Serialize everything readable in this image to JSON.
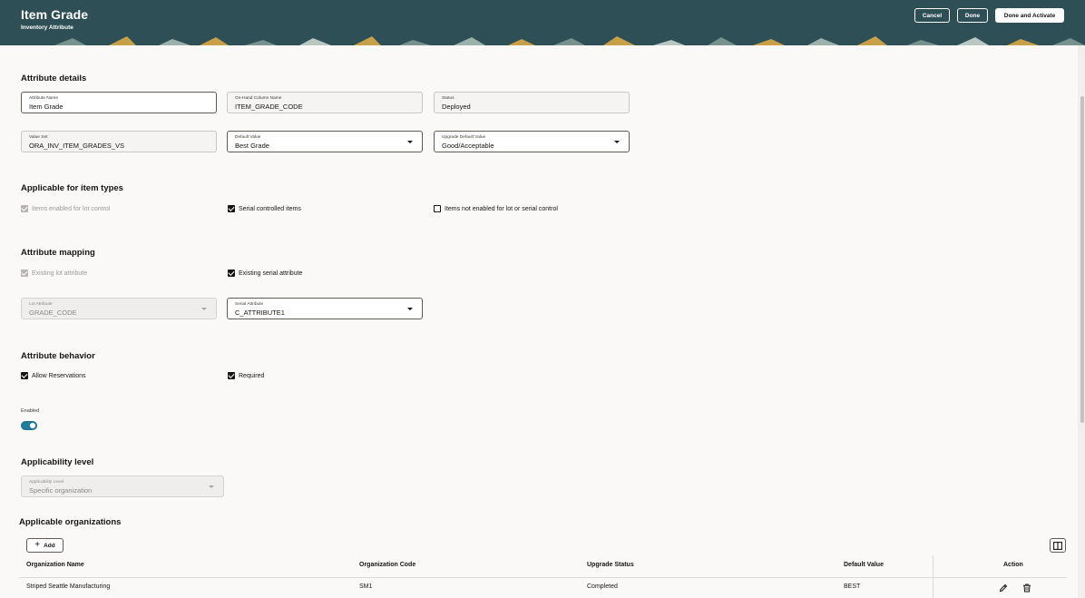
{
  "header": {
    "title": "Item Grade",
    "subtitle": "Inventory Attribute",
    "cancel_label": "Cancel",
    "done_label": "Done",
    "done_activate_label": "Done and Activate"
  },
  "attribute_details": {
    "title": "Attribute details",
    "attribute_name": {
      "label": "Attribute Name",
      "value": "Item Grade"
    },
    "onhand_column": {
      "label": "On-Hand Column Name",
      "value": "ITEM_GRADE_CODE"
    },
    "status": {
      "label": "Status",
      "value": "Deployed"
    },
    "value_set": {
      "label": "Value Set",
      "value": "ORA_INV_ITEM_GRADES_VS"
    },
    "default_value": {
      "label": "Default Value",
      "value": "Best Grade"
    },
    "upgrade_default": {
      "label": "Upgrade Default Value",
      "value": "Good/Acceptable"
    }
  },
  "item_types": {
    "title": "Applicable for item types",
    "lot_control": {
      "label": "Items enabled for lot control",
      "checked": true,
      "disabled": true
    },
    "serial_controlled": {
      "label": "Serial controlled items",
      "checked": true
    },
    "not_enabled": {
      "label": "Items not enabled for lot or serial control",
      "checked": false
    }
  },
  "mapping": {
    "title": "Attribute mapping",
    "existing_lot": {
      "label": "Existing lot attribute",
      "checked": true,
      "disabled": true
    },
    "existing_serial": {
      "label": "Existing serial attribute",
      "checked": true
    },
    "lot_attribute": {
      "label": "Lot Attribute",
      "value": "GRADE_CODE"
    },
    "serial_attribute": {
      "label": "Serial Attribute",
      "value": "C_ATTRIBUTE1"
    }
  },
  "behavior": {
    "title": "Attribute behavior",
    "allow_reservations": {
      "label": "Allow Reservations",
      "checked": true
    },
    "required": {
      "label": "Required",
      "checked": true
    },
    "enabled_label": "Enabled",
    "enabled": true
  },
  "applicability": {
    "title": "Applicability level",
    "level": {
      "label": "Applicability Level",
      "value": "Specific organization"
    }
  },
  "organizations": {
    "title": "Applicable organizations",
    "add_label": "Add",
    "columns": [
      "Organization Name",
      "Organization Code",
      "Upgrade Status",
      "Default Value",
      "Action"
    ],
    "rows": [
      {
        "name": "Striped Seattle Manufacturing",
        "code": "SM1",
        "upgrade_status": "Completed",
        "default_value": "BEST"
      }
    ]
  },
  "colors": {
    "header_bg": "#2f4f56",
    "toggle_on": "#227e9e",
    "pattern_gold": "#d8a948",
    "pattern_sage": "#7f9a93"
  }
}
